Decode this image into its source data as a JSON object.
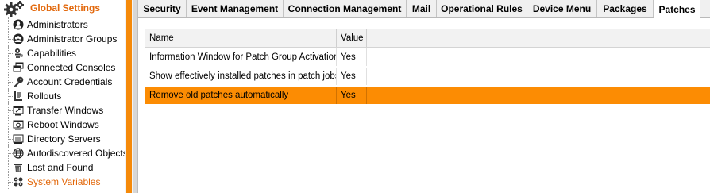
{
  "tree": {
    "root_label": "Global Settings",
    "root_icon": "gear-icon",
    "items": [
      {
        "label": "Administrators",
        "icon": "administrator-icon"
      },
      {
        "label": "Administrator Groups",
        "icon": "administrator-groups-icon"
      },
      {
        "label": "Capabilities",
        "icon": "capabilities-icon"
      },
      {
        "label": "Connected Consoles",
        "icon": "consoles-icon"
      },
      {
        "label": "Account Credentials",
        "icon": "key-icon"
      },
      {
        "label": "Rollouts",
        "icon": "rollouts-icon"
      },
      {
        "label": "Transfer Windows",
        "icon": "transfer-window-icon"
      },
      {
        "label": "Reboot Windows",
        "icon": "reboot-window-icon"
      },
      {
        "label": "Directory Servers",
        "icon": "directory-server-icon"
      },
      {
        "label": "Autodiscovered Objects",
        "icon": "globe-icon"
      },
      {
        "label": "Lost and Found",
        "icon": "trash-icon"
      },
      {
        "label": "System Variables",
        "icon": "variables-icon",
        "active": true
      }
    ]
  },
  "tabs": [
    {
      "label": "Security"
    },
    {
      "label": "Event Management"
    },
    {
      "label": "Connection Management"
    },
    {
      "label": "Mail"
    },
    {
      "label": "Operational Rules"
    },
    {
      "label": "Device Menu"
    },
    {
      "label": "Packages"
    },
    {
      "label": "Patches",
      "selected": true
    }
  ],
  "grid": {
    "columns": [
      "Name",
      "Value"
    ],
    "rows": [
      {
        "name": "Information Window for Patch Group Activation",
        "value": "Yes"
      },
      {
        "name": "Show effectively installed patches in patch jobs",
        "value": "Yes"
      },
      {
        "name": "Remove old patches automatically",
        "value": "Yes",
        "selected": true
      }
    ]
  },
  "colors": {
    "accent": "#fc8c03",
    "accent_text": "#e2670a"
  }
}
